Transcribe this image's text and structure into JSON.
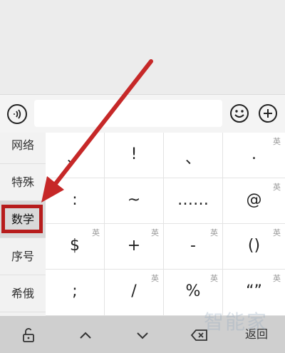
{
  "input_bar": {
    "voice_icon": "voice-wave-icon",
    "emoji_icon": "smiley-icon",
    "plus_icon": "plus-icon"
  },
  "categories": [
    {
      "label": "网络"
    },
    {
      "label": "特殊"
    },
    {
      "label": "数学",
      "active": true
    },
    {
      "label": "序号"
    },
    {
      "label": "希俄"
    }
  ],
  "keys": [
    {
      "sym": "、",
      "tag": ""
    },
    {
      "sym": "!",
      "tag": ""
    },
    {
      "sym": "、",
      "tag": ""
    },
    {
      "sym": ".",
      "tag": "英"
    },
    {
      "sym": ":",
      "tag": ""
    },
    {
      "sym": "~",
      "tag": ""
    },
    {
      "sym": "……",
      "tag": ""
    },
    {
      "sym": "@",
      "tag": "英"
    },
    {
      "sym": "$",
      "tag": "英"
    },
    {
      "sym": "+",
      "tag": "英"
    },
    {
      "sym": "-",
      "tag": "英"
    },
    {
      "sym": "()",
      "tag": "英"
    },
    {
      "sym": ";",
      "tag": ""
    },
    {
      "sym": "/",
      "tag": "英"
    },
    {
      "sym": "%",
      "tag": "英"
    },
    {
      "sym": "“”",
      "tag": "英"
    }
  ],
  "toolbar": {
    "lock_icon": "unlock-icon",
    "up_icon": "chevron-up-icon",
    "down_icon": "chevron-down-icon",
    "delete_icon": "backspace-icon",
    "return_label": "返回"
  },
  "watermark": "智能家",
  "colors": {
    "highlight": "#b71c1c",
    "arrow": "#c62828"
  }
}
